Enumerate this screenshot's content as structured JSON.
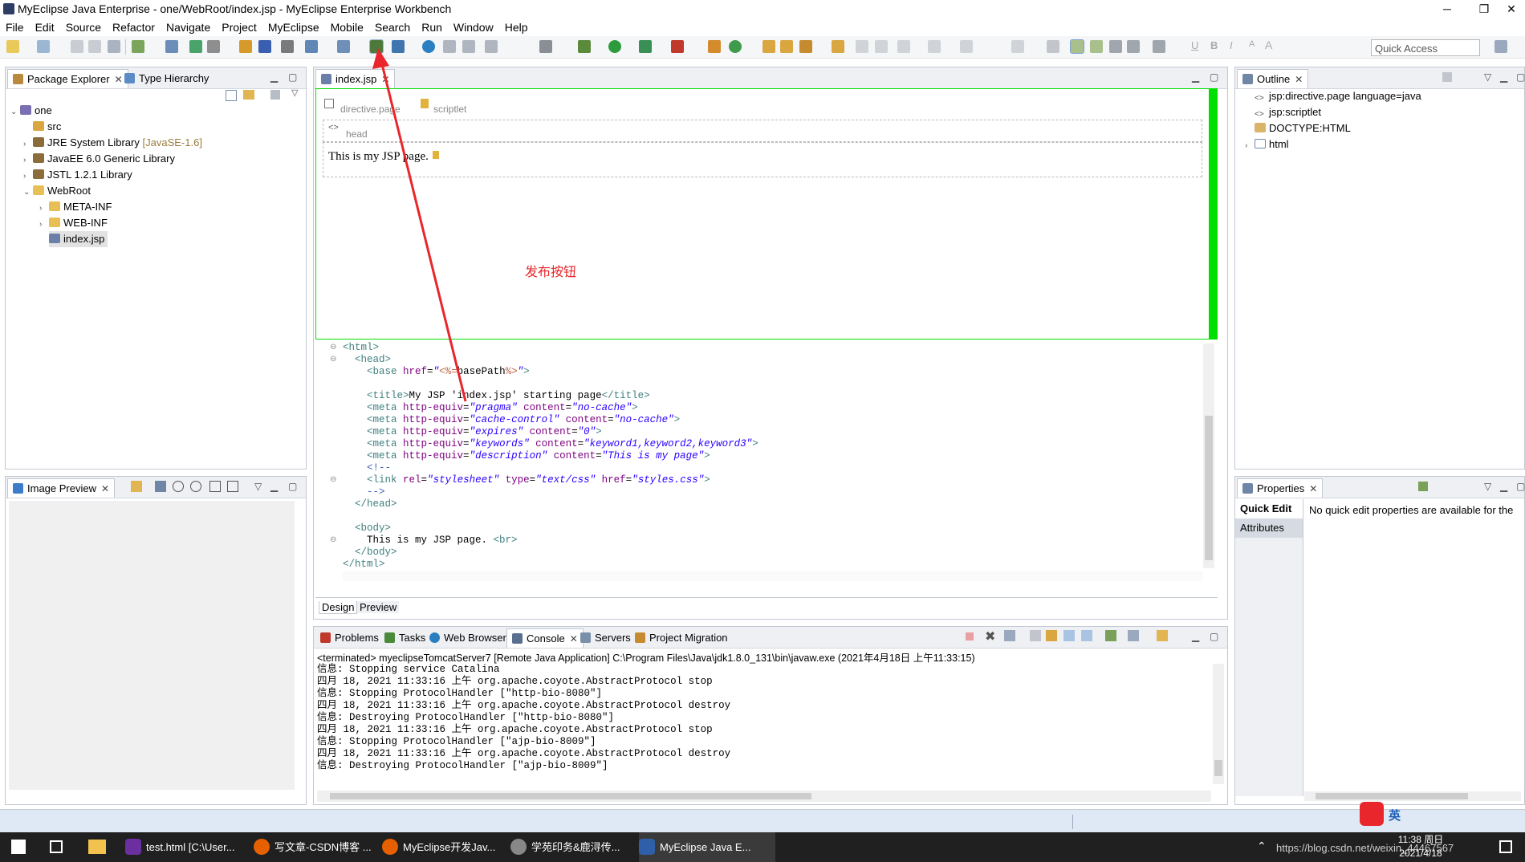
{
  "window": {
    "title": "MyEclipse Java Enterprise - one/WebRoot/index.jsp - MyEclipse Enterprise Workbench",
    "controls": [
      "─",
      "❐",
      "✕"
    ]
  },
  "menu": [
    "File",
    "Edit",
    "Source",
    "Refactor",
    "Navigate",
    "Project",
    "MyEclipse",
    "Mobile",
    "Search",
    "Run",
    "Window",
    "Help"
  ],
  "toolbar": {
    "quick_access_placeholder": "Quick Access"
  },
  "package_explorer": {
    "tabs": [
      "Package Explorer",
      "Type Hierarchy"
    ],
    "tree": [
      {
        "label": "one",
        "level": 0,
        "twisty": "expanded",
        "icon": "project-icon"
      },
      {
        "label": "src",
        "level": 1,
        "twisty": "",
        "icon": "package-folder-icon"
      },
      {
        "label": "JRE System Library",
        "suffix": "[JavaSE-1.6]",
        "level": 1,
        "twisty": "collapsed",
        "icon": "library-icon"
      },
      {
        "label": "JavaEE 6.0 Generic Library",
        "level": 1,
        "twisty": "collapsed",
        "icon": "library-icon"
      },
      {
        "label": "JSTL 1.2.1 Library",
        "level": 1,
        "twisty": "collapsed",
        "icon": "library-icon"
      },
      {
        "label": "WebRoot",
        "level": 1,
        "twisty": "expanded",
        "icon": "folder-icon"
      },
      {
        "label": "META-INF",
        "level": 2,
        "twisty": "collapsed",
        "icon": "folder-icon"
      },
      {
        "label": "WEB-INF",
        "level": 2,
        "twisty": "collapsed",
        "icon": "folder-icon"
      },
      {
        "label": "index.jsp",
        "level": 2,
        "twisty": "",
        "icon": "jsp-file-icon",
        "selected": true
      }
    ]
  },
  "image_preview": {
    "tab": "Image Preview"
  },
  "editor": {
    "tab": "index.jsp",
    "design": {
      "directive_label": "directive.page",
      "scriptlet_label": "scriptlet",
      "head_label": "head",
      "body_text": "This is my JSP page."
    },
    "annotation": "发布按钮",
    "bottom_tabs": [
      "Design",
      "Preview"
    ]
  },
  "outline": {
    "tab": "Outline",
    "items": [
      {
        "label": "jsp:directive.page language=java",
        "icon": "tag-icon",
        "twisty": ""
      },
      {
        "label": "jsp:scriptlet",
        "icon": "tag-icon",
        "twisty": ""
      },
      {
        "label": "DOCTYPE:HTML",
        "icon": "doctype-icon",
        "twisty": ""
      },
      {
        "label": "html",
        "icon": "element-icon",
        "twisty": "collapsed"
      }
    ]
  },
  "properties": {
    "tab": "Properties",
    "side_tabs": [
      "Quick Edit",
      "Attributes"
    ],
    "message": "No quick edit properties are available for the"
  },
  "console": {
    "tabs": [
      "Problems",
      "Tasks",
      "Web Browser",
      "Console",
      "Servers",
      "Project Migration"
    ],
    "header": "<terminated> myeclipseTomcatServer7 [Remote Java Application] C:\\Program Files\\Java\\jdk1.8.0_131\\bin\\javaw.exe (2021年4月18日 上午11:33:15)",
    "lines": [
      "信息: Stopping service Catalina",
      "四月 18, 2021 11:33:16 上午 org.apache.coyote.AbstractProtocol stop",
      "信息: Stopping ProtocolHandler [\"http-bio-8080\"]",
      "四月 18, 2021 11:33:16 上午 org.apache.coyote.AbstractProtocol destroy",
      "信息: Destroying ProtocolHandler [\"http-bio-8080\"]",
      "四月 18, 2021 11:33:16 上午 org.apache.coyote.AbstractProtocol stop",
      "信息: Stopping ProtocolHandler [\"ajp-bio-8009\"]",
      "四月 18, 2021 11:33:16 上午 org.apache.coyote.AbstractProtocol destroy",
      "信息: Destroying ProtocolHandler [\"ajp-bio-8009\"]"
    ]
  },
  "taskbar": {
    "items": [
      {
        "label": "test.html [C:\\User...",
        "color": "#6b2fa0"
      },
      {
        "label": "写文章-CSDN博客 ...",
        "color": "#e66000"
      },
      {
        "label": "MyEclipse开发Jav...",
        "color": "#e66000"
      },
      {
        "label": "学苑印务&鹿浔传...",
        "color": "#888888"
      },
      {
        "label": "MyEclipse Java E...",
        "color": "#2f5fa8"
      }
    ],
    "clock_time": "11:38 周日",
    "clock_date": "2021/4/18",
    "ime": "英",
    "watermark": "https://blog.csdn.net/weixin_44467567"
  },
  "colors": {
    "accent_green": "#00e000",
    "annotation_red": "#e8262b",
    "panel_border": "#c3c9d2"
  }
}
